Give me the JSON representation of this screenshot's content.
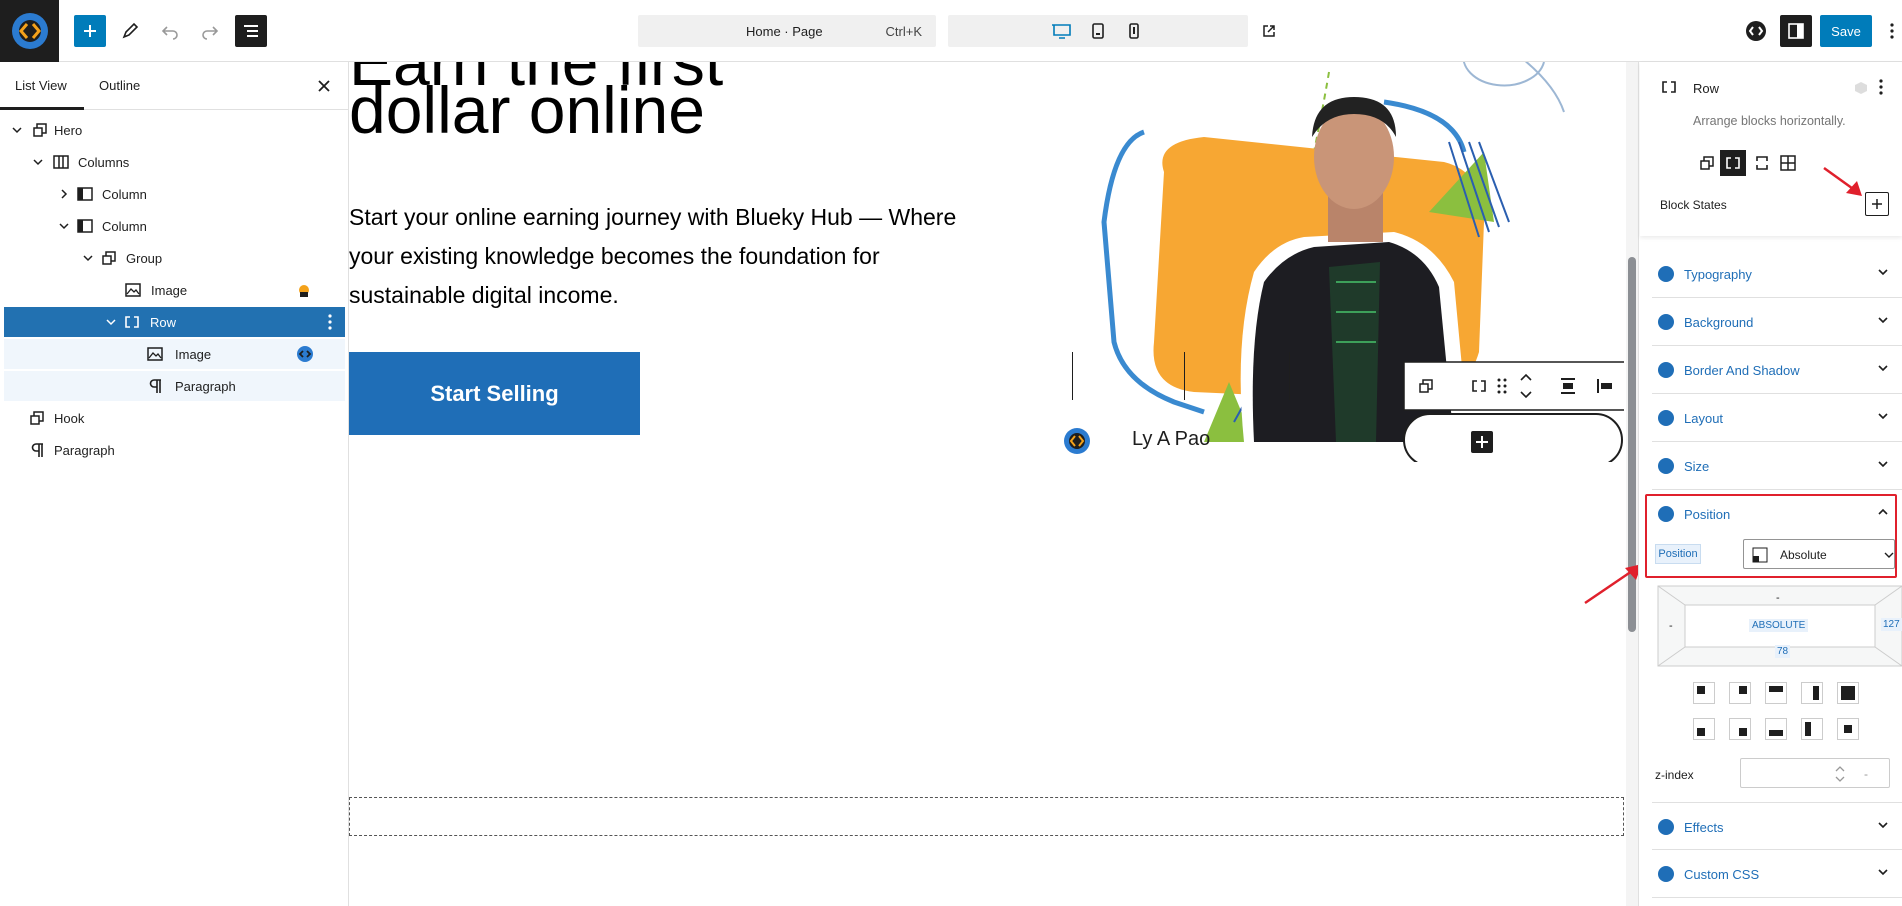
{
  "topbar": {
    "command": {
      "title": "Home · Page",
      "shortcut": "Ctrl+K"
    },
    "save_label": "Save"
  },
  "list_view": {
    "tabs": [
      "List View",
      "Outline"
    ],
    "items": [
      {
        "label": "Hero"
      },
      {
        "label": "Columns"
      },
      {
        "label": "Column"
      },
      {
        "label": "Column"
      },
      {
        "label": "Group"
      },
      {
        "label": "Image"
      },
      {
        "label": "Row"
      },
      {
        "label": "Image"
      },
      {
        "label": "Paragraph"
      },
      {
        "label": "Hook"
      },
      {
        "label": "Paragraph"
      }
    ]
  },
  "canvas": {
    "heading_partial": "Earn the first",
    "heading_line2": "dollar online",
    "lede": "Start your online earning journey with Blueky Hub — Where your existing knowledge becomes the foundation for sustainable digital income.",
    "cta": "Start Selling",
    "name_pill": "Ly A Pao"
  },
  "inspector": {
    "block_title": "Row",
    "block_desc": "Arrange blocks horizontally.",
    "block_states_label": "Block States",
    "sections": [
      "Typography",
      "Background",
      "Border And Shadow",
      "Layout",
      "Size",
      "Position",
      "Effects",
      "Custom CSS"
    ],
    "position": {
      "label": "Position",
      "value": "Absolute",
      "box_center": "ABSOLUTE",
      "top": "-",
      "left": "-",
      "right": "127",
      "bottom": "78",
      "zindex_label": "z-index",
      "zindex_value": "-"
    },
    "accent": "#1f6eb7",
    "highlight": "#e0202c"
  }
}
